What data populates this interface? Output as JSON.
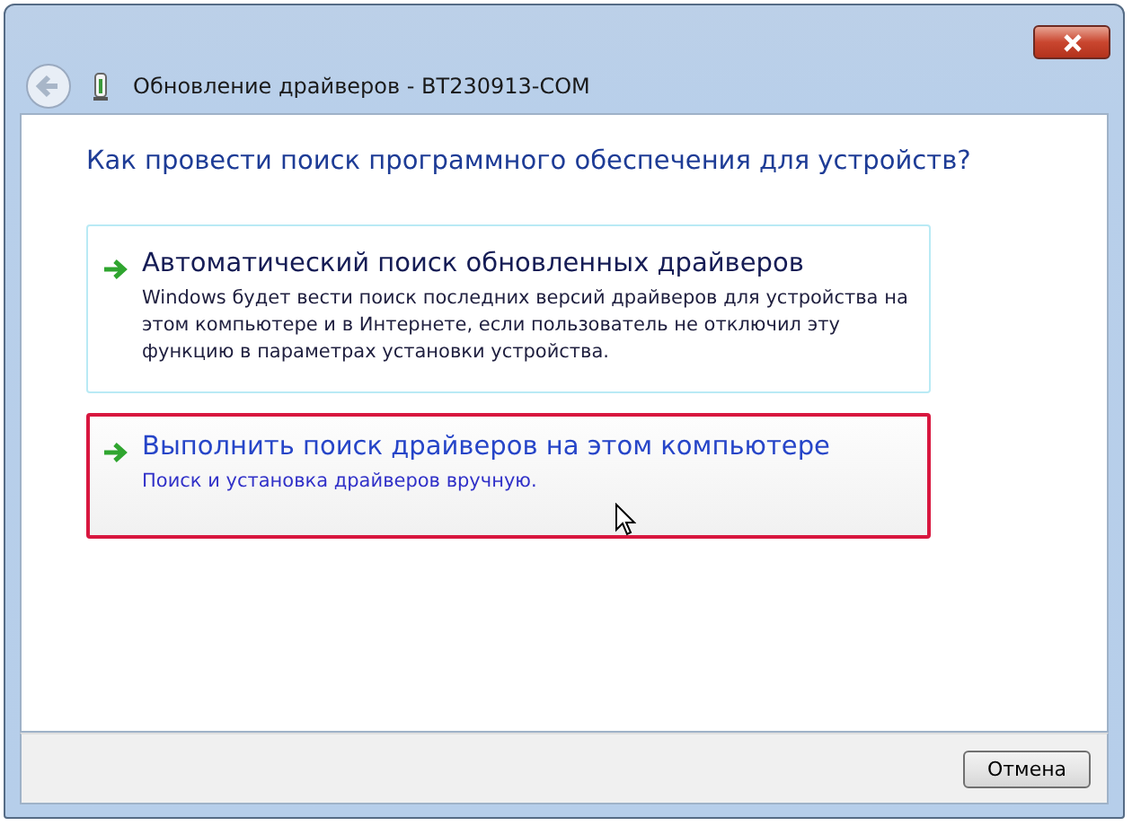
{
  "window": {
    "title": "Обновление драйверов - BT230913-COM"
  },
  "heading": "Как провести поиск программного обеспечения для устройств?",
  "options": [
    {
      "title": "Автоматический поиск обновленных драйверов",
      "description": "Windows будет вести поиск последних версий драйверов для устройства на этом компьютере и в Интернете, если пользователь не отключил эту функцию в параметрах установки устройства.",
      "selected": false
    },
    {
      "title": "Выполнить поиск драйверов на этом компьютере",
      "description": "Поиск и установка драйверов вручную.",
      "selected": true
    }
  ],
  "buttons": [
    "Отмена"
  ]
}
